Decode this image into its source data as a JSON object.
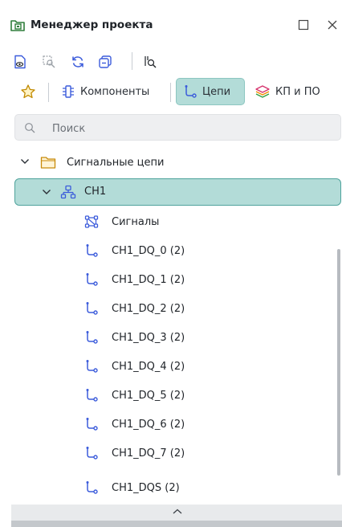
{
  "window": {
    "title": "Менеджер проекта",
    "icons": {
      "app": "folder-board-icon",
      "maximize": "maximize-square-icon",
      "close": "close-icon"
    }
  },
  "toolbar": {
    "icons": [
      "document-view-icon",
      "zoom-select-icon",
      "refresh-icon",
      "collapse-window-icon",
      "filter-search-icon"
    ]
  },
  "tabs": {
    "favorites_icon": "star-icon",
    "items": [
      {
        "label": "Компоненты",
        "icon": "component-icon",
        "active": false
      },
      {
        "label": "Цепи",
        "icon": "net-icon",
        "active": true
      },
      {
        "label": "КП и ПО",
        "icon": "layers-icon",
        "active": false
      }
    ]
  },
  "search": {
    "placeholder": "Поиск",
    "value": ""
  },
  "tree": {
    "root": {
      "label": "Сигнальные цепи",
      "icon": "folder-icon",
      "expanded": true
    },
    "group": {
      "label": "CH1",
      "icon": "net-group-icon",
      "expanded": true,
      "selected": true
    },
    "children": [
      {
        "label": "Сигналы",
        "icon": "signals-icon"
      },
      {
        "label": "CH1_DQ_0 (2)",
        "icon": "net-icon"
      },
      {
        "label": "CH1_DQ_1 (2)",
        "icon": "net-icon"
      },
      {
        "label": "CH1_DQ_2 (2)",
        "icon": "net-icon"
      },
      {
        "label": "CH1_DQ_3 (2)",
        "icon": "net-icon"
      },
      {
        "label": "CH1_DQ_4 (2)",
        "icon": "net-icon"
      },
      {
        "label": "CH1_DQ_5 (2)",
        "icon": "net-icon"
      },
      {
        "label": "CH1_DQ_6 (2)",
        "icon": "net-icon"
      },
      {
        "label": "CH1_DQ_7 (2)",
        "icon": "net-icon"
      },
      {
        "label": "CH1_DQS (2)",
        "icon": "net-icon"
      }
    ]
  },
  "colors": {
    "accent": "#b3dcd8",
    "accent_border": "#4fa39c",
    "icon_blue": "#3b5bdb"
  }
}
